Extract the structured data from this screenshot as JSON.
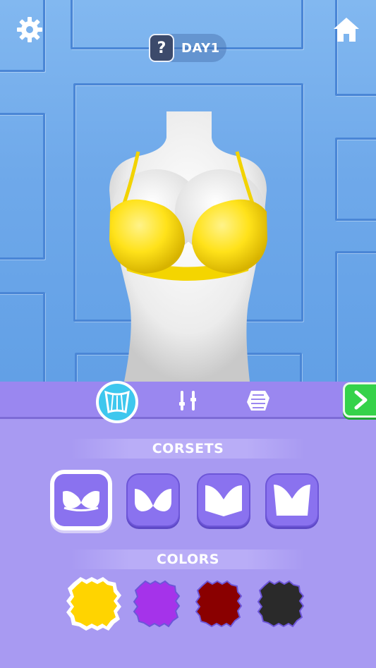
{
  "header": {
    "settings_icon": "gear-icon",
    "home_icon": "home-icon",
    "help_glyph": "?",
    "day_label": "DAY1"
  },
  "tools": [
    {
      "name": "corset-tool",
      "icon": "corset-icon",
      "active": true
    },
    {
      "name": "straps-tool",
      "icon": "straps-icon",
      "active": false
    },
    {
      "name": "pattern-tool",
      "icon": "fabric-icon",
      "active": false
    }
  ],
  "next_icon": "chevron-right-icon",
  "corsets": {
    "title": "CORSETS",
    "items": [
      {
        "style": "balconette",
        "selected": true
      },
      {
        "style": "plunge",
        "selected": false
      },
      {
        "style": "bustier",
        "selected": false
      },
      {
        "style": "longline",
        "selected": false
      }
    ]
  },
  "colors": {
    "title": "COLORS",
    "items": [
      {
        "name": "yellow",
        "hex": "#ffd400",
        "selected": true
      },
      {
        "name": "purple",
        "hex": "#a533ea",
        "selected": false
      },
      {
        "name": "dark-red",
        "hex": "#8a0000",
        "selected": false
      },
      {
        "name": "black",
        "hex": "#2a2a2a",
        "selected": false
      }
    ]
  },
  "garment_color": "#ffe21a"
}
